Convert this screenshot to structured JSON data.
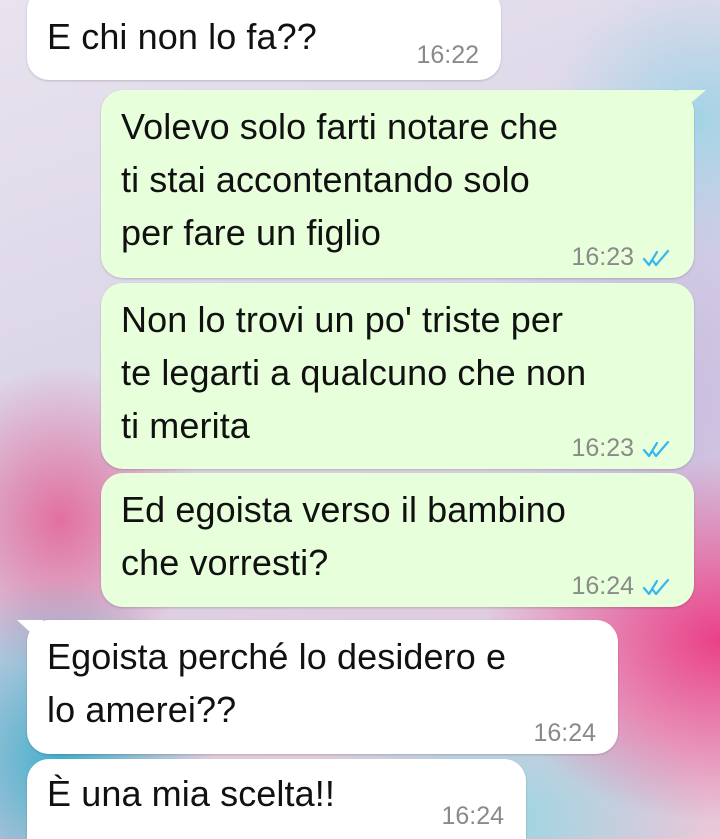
{
  "messages": [
    {
      "direction": "incoming",
      "text": "E chi non lo fa??",
      "time": "16:22"
    },
    {
      "direction": "outgoing",
      "text": "Volevo solo farti notare che\nti stai accontentando solo\nper fare un figlio",
      "time": "16:23",
      "status": "read"
    },
    {
      "direction": "outgoing",
      "text": "Non lo trovi un po' triste per\nte legarti a qualcuno che non\nti merita",
      "time": "16:23",
      "status": "read"
    },
    {
      "direction": "outgoing",
      "text": "Ed egoista verso il bambino\nche vorresti?",
      "time": "16:24",
      "status": "read"
    },
    {
      "direction": "incoming",
      "text": "Egoista perché lo desidero e\nlo amerei??",
      "time": "16:24"
    },
    {
      "direction": "incoming",
      "text": "È una mia scelta!!",
      "time": "16:24"
    }
  ],
  "colors": {
    "incoming_bubble": "#ffffff",
    "outgoing_bubble": "#e7ffdb",
    "timestamp": "#8a8a8a",
    "read_ticks": "#34b7f1"
  },
  "icons": {
    "read_status": "double-check-icon"
  }
}
